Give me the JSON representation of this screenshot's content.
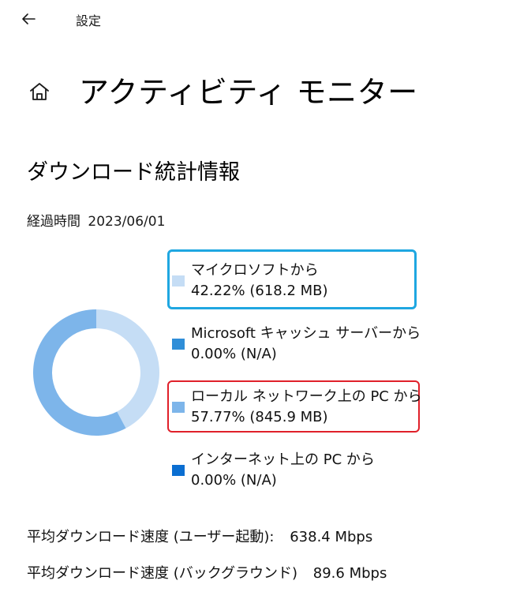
{
  "nav": {
    "title": "設定"
  },
  "header": {
    "title": "アクティビティ モニター"
  },
  "section": {
    "title": "ダウンロード統計情報",
    "elapsed_label": "経過時間",
    "elapsed_value": "2023/06/01"
  },
  "chart_data": {
    "type": "pie",
    "style": "donut",
    "categories": [
      "マイクロソフトから",
      "Microsoft キャッシュ サーバーから",
      "ローカル ネットワーク上の PC から",
      "インターネット上の PC から"
    ],
    "values": [
      42.22,
      0.0,
      57.77,
      0.0
    ],
    "colors": [
      "#c5ddf5",
      "#2f8ed8",
      "#7db5ea",
      "#0a6ed1"
    ]
  },
  "legend": [
    {
      "name": "マイクロソフトから",
      "value": "42.22%  (618.2 MB)",
      "color": "#c5ddf5"
    },
    {
      "name": "Microsoft キャッシュ サーバーから",
      "value": "0.00%  (N/A)",
      "color": "#2f8ed8"
    },
    {
      "name": "ローカル ネットワーク上の PC から",
      "value": "57.77%  (845.9 MB)",
      "color": "#7db5ea"
    },
    {
      "name": "インターネット上の PC から",
      "value": "0.00%  (N/A)",
      "color": "#0a6ed1"
    }
  ],
  "speeds": [
    {
      "label": "平均ダウンロード速度 (ユーザー起動):",
      "value": "638.4 Mbps"
    },
    {
      "label": "平均ダウンロード速度 (バックグラウンド)",
      "value": "89.6 Mbps"
    }
  ],
  "highlight_colors": {
    "blue": "#1fa7e1",
    "red": "#e0202a"
  },
  "icons": [
    "arrow-left-icon",
    "home-icon"
  ]
}
